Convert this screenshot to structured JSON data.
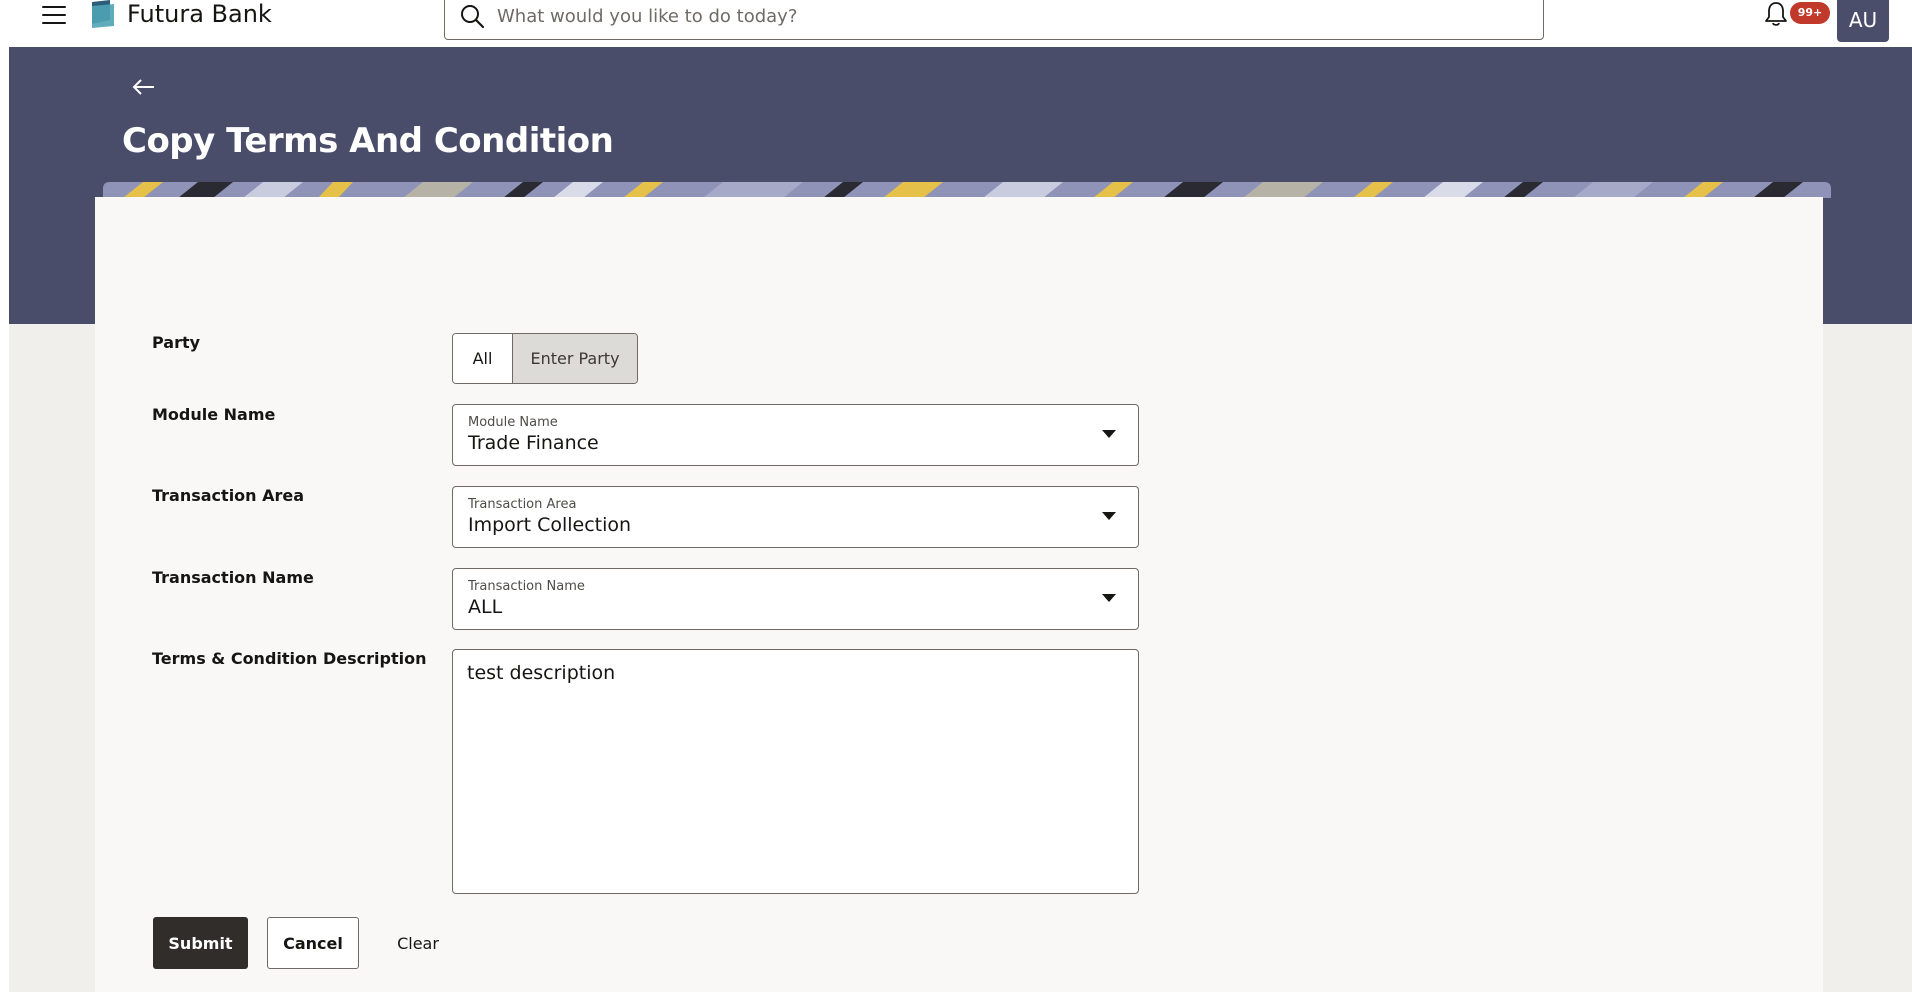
{
  "header": {
    "brand": "Futura Bank",
    "search_placeholder": "What would you like to do today?",
    "notification_count": "99+",
    "user_initials": "AU"
  },
  "page": {
    "title": "Copy Terms And Condition"
  },
  "form": {
    "party": {
      "label": "Party",
      "options": [
        "All",
        "Enter Party"
      ],
      "selected": "Enter Party"
    },
    "module_name": {
      "label": "Module Name",
      "field_label": "Module Name",
      "value": "Trade Finance"
    },
    "transaction_area": {
      "label": "Transaction Area",
      "field_label": "Transaction Area",
      "value": "Import Collection"
    },
    "transaction_name": {
      "label": "Transaction Name",
      "field_label": "Transaction Name",
      "value": "ALL"
    },
    "description": {
      "label": "Terms & Condition Description",
      "value": "test description"
    }
  },
  "actions": {
    "submit": "Submit",
    "cancel": "Cancel",
    "clear": "Clear"
  },
  "colors": {
    "hero": "#4a4d6a",
    "primary_button": "#312d2a",
    "badge": "#c0392b",
    "avatar": "#4b4e6b"
  }
}
